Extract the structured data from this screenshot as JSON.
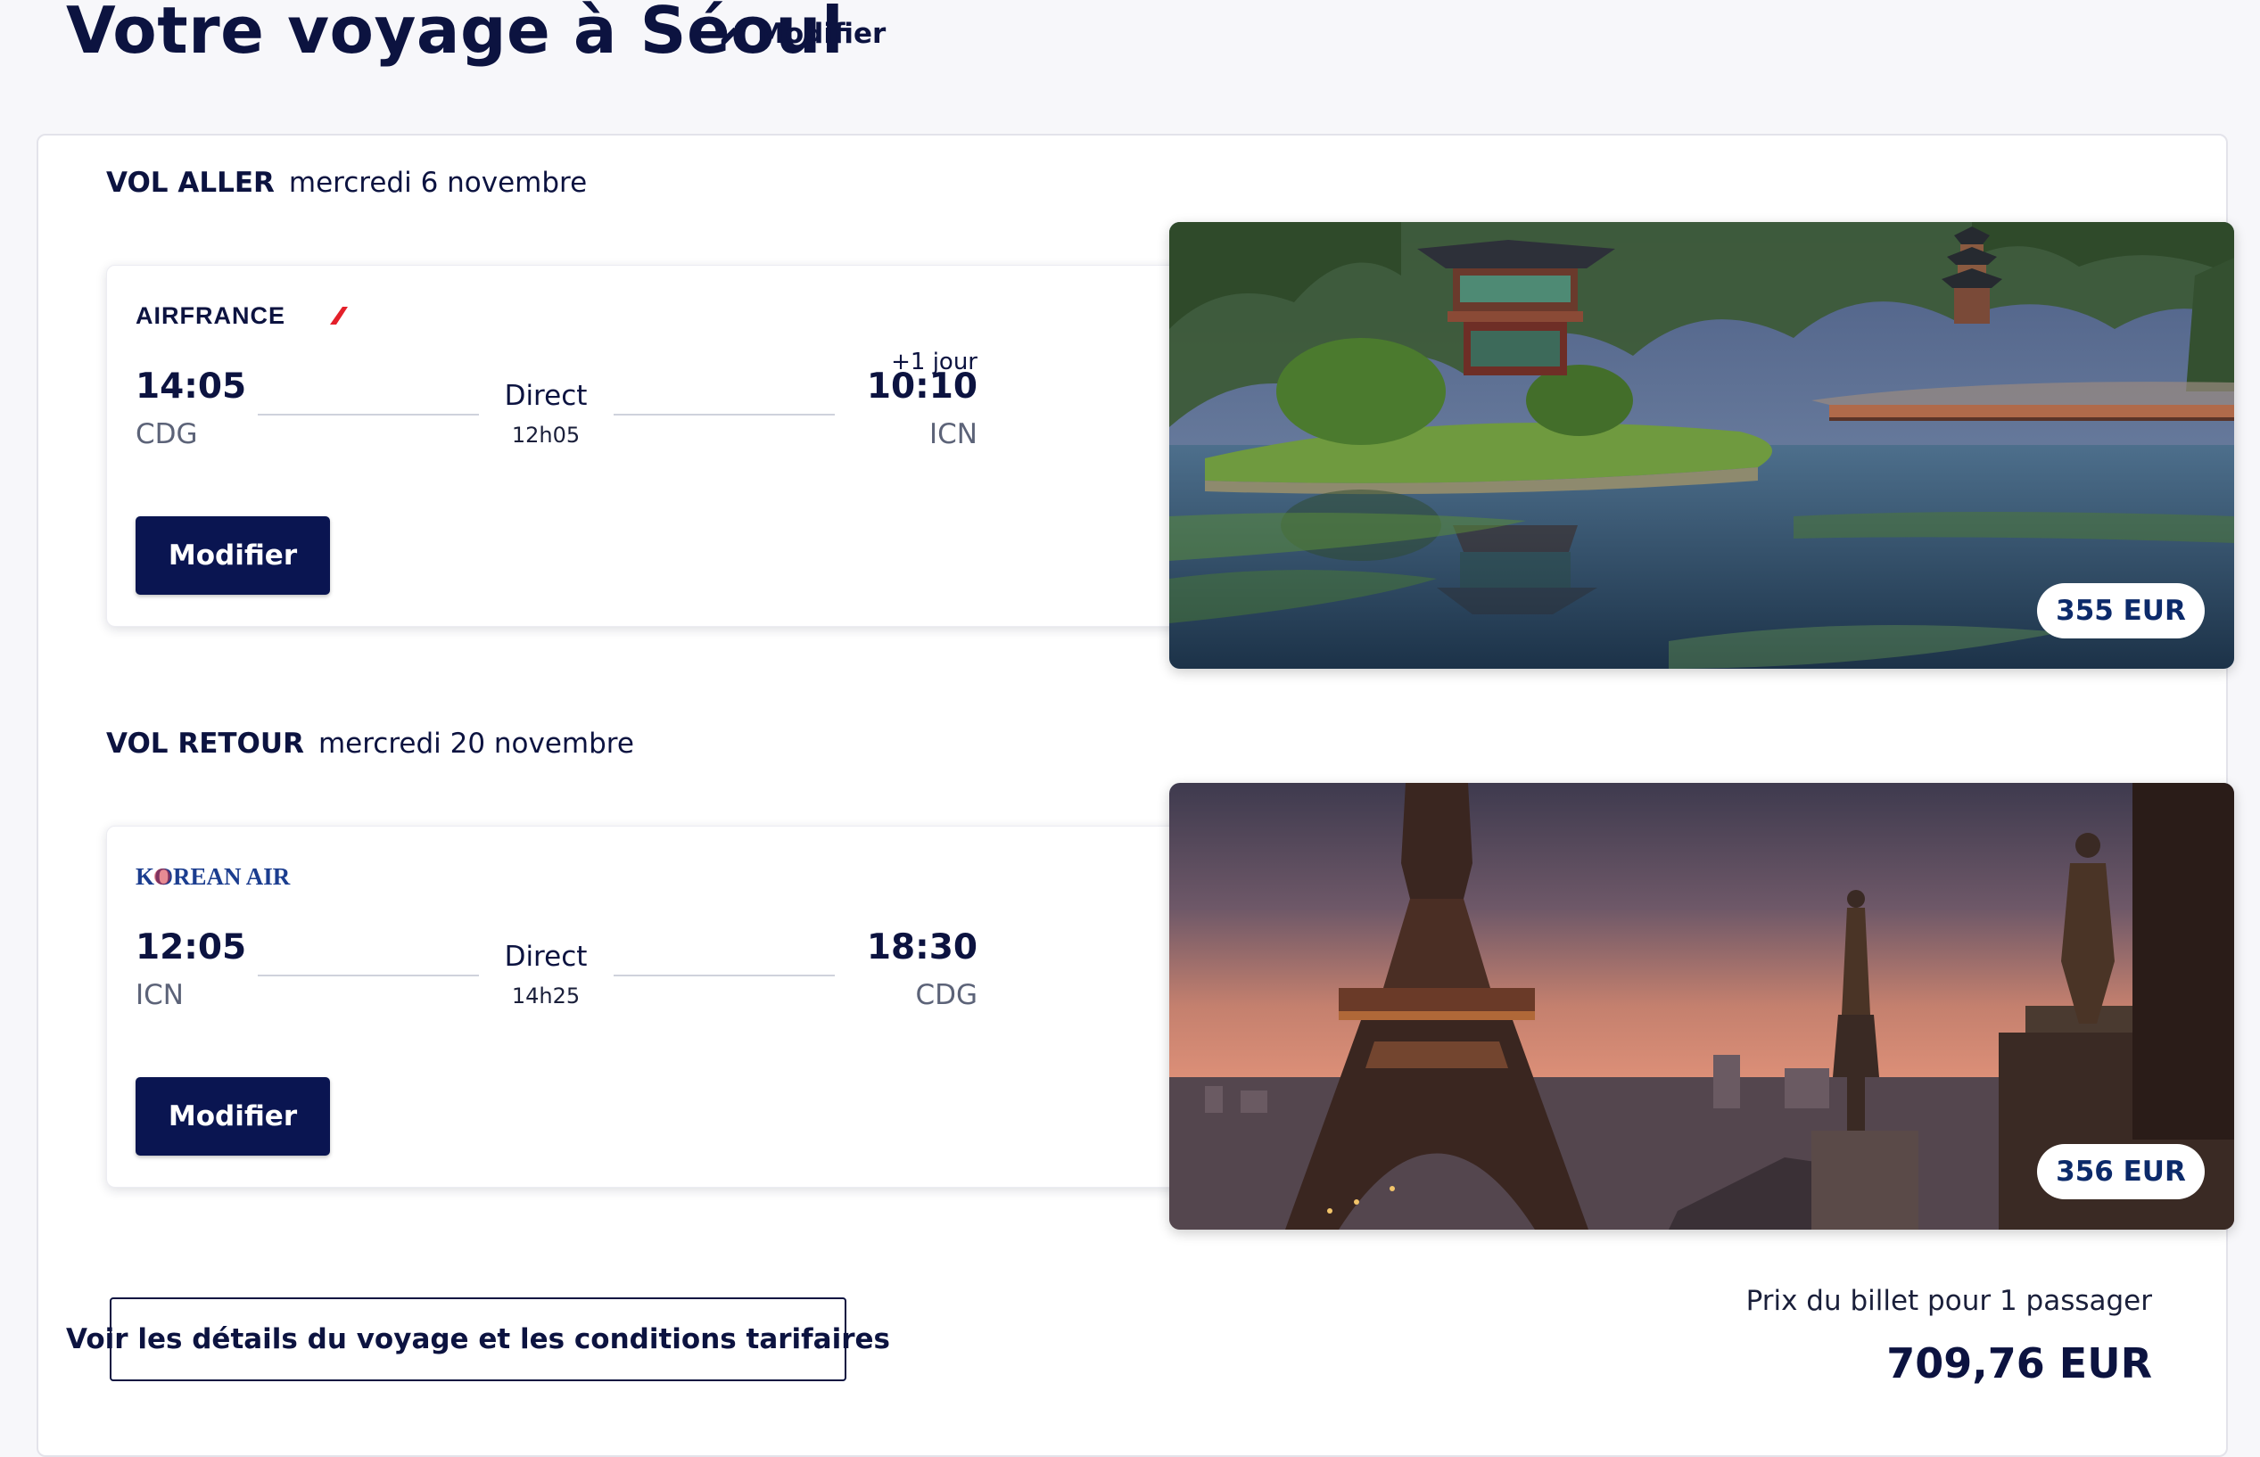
{
  "page": {
    "title": "Votre voyage à Séoul",
    "edit_label": "Modifier"
  },
  "outbound": {
    "heading": "VOL ALLER",
    "date": "mercredi 6 novembre",
    "airline": "AIRFRANCE",
    "dep_time": "14:05",
    "dep_code": "CDG",
    "stops": "Direct",
    "duration": "12h05",
    "day_offset": "+1 jour",
    "arr_time": "10:10",
    "arr_code": "ICN",
    "modify_label": "Modifier",
    "price": "355 EUR"
  },
  "inbound": {
    "heading": "VOL RETOUR",
    "date": "mercredi 20 novembre",
    "airline": "KOREAN AIR",
    "dep_time": "12:05",
    "dep_code": "ICN",
    "stops": "Direct",
    "duration": "14h25",
    "arr_time": "18:30",
    "arr_code": "CDG",
    "modify_label": "Modifier",
    "price": "356 EUR"
  },
  "footer": {
    "details_label": "Voir les détails du voyage et les conditions tarifaires",
    "price_caption": "Prix du billet pour 1 passager",
    "total": "709,76 EUR"
  },
  "colors": {
    "navy": "#0a1551",
    "text": "#0c1340",
    "price_text": "#0c2a6a",
    "airfrance_red": "#e4202a",
    "korean_blue": "#1b3d8f"
  },
  "icons": [
    "pencil-icon",
    "airfrance-logo",
    "korean-air-logo"
  ]
}
